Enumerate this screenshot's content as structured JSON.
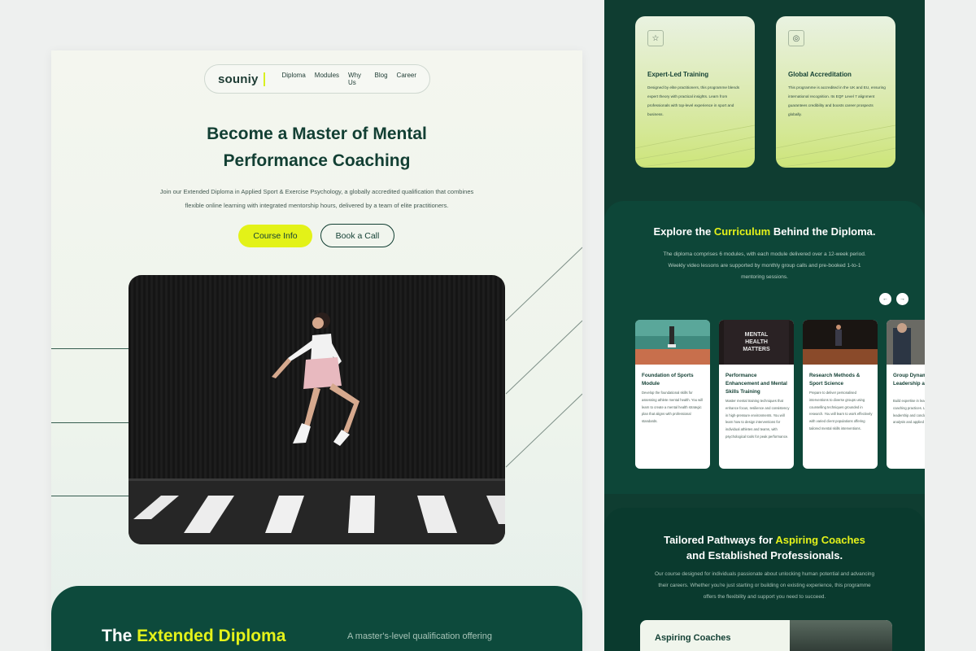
{
  "nav": {
    "logo": "souniy",
    "links": [
      "Diploma",
      "Modules",
      "Why Us",
      "Blog",
      "Career"
    ]
  },
  "hero": {
    "title_line1": "Become a Master of Mental",
    "title_line2": "Performance Coaching",
    "text_line1": "Join our Extended Diploma in Applied Sport & Exercise Psychology, a globally accredited qualification that combines",
    "text_line2": "flexible online learning with integrated mentorship hours, delivered by a team of elite practitioners.",
    "btn_primary": "Course Info",
    "btn_secondary": "Book a Call"
  },
  "extended": {
    "title_pre": "The ",
    "title_highlight": "Extended Diploma",
    "subtitle": "A master's-level qualification offering"
  },
  "features": [
    {
      "icon": "star-icon",
      "title": "Expert-Led Training",
      "text": "Designed by elite practitioners, this programme blends expert theory with practical insights. Learn from professionals with top-level experience in sport and business."
    },
    {
      "icon": "globe-icon",
      "title": "Global Accreditation",
      "text": "This programme is accredited in the UK and EU, ensuring international recognition. Its EQF Level 7 alignment guarantees credibility and boosts career prospects globally."
    }
  ],
  "curriculum": {
    "title_pre": "Explore the ",
    "title_highlight": "Curriculum",
    "title_post": " Behind the Diploma.",
    "text_line1": "The diploma comprises 6 modules, with each module delivered over a 12-week period.",
    "text_line2": "Weekly video lessons are supported by monthly group calls and pre-booked 1-to-1",
    "text_line3": "mentoring sessions.",
    "prev": "←",
    "next": "→",
    "modules": [
      {
        "title": "Foundation of Sports Module",
        "text": "Develop the foundational skills for assessing athlete mental health. You will learn to create a mental health strategic plan that aligns with professional standards."
      },
      {
        "title": "Performance Enhancement and Mental Skills Training",
        "text": "Master mental training techniques that enhance focus, resilience and consistency in high-pressure environments. You will learn how to design interventions for individual athletes and teams, with psychological tools for peak performance."
      },
      {
        "title": "Research Methods & Sport Science",
        "text": "Prepare to deliver personalised interventions to diverse groups using counselling techniques grounded in research. You will learn to work effectively with varied client populations offering tailored mental skills interventions."
      },
      {
        "title": "Group Dynamics, Leadership and Coaching",
        "text": "Build expertise in leading and developing coaching practices. Learn to design leadership and conduct psychological analysis and applied psychology."
      }
    ],
    "shirt_text": [
      "MENTAL",
      "HEALTH",
      "MATTERS"
    ]
  },
  "pathways": {
    "title_pre": "Tailored Pathways for ",
    "title_highlight": "Aspiring Coaches",
    "title_line2": "and Established Professionals.",
    "text_line1": "Our course designed for individuals passionate about unlocking human potential and advancing",
    "text_line2": "their careers. Whether you're just starting or building on existing experience, this programme",
    "text_line3": "offers the flexibility and support you need to succeed.",
    "card_title": "Aspiring Coaches"
  },
  "colors": {
    "brand_dark": "#0d4a3c",
    "accent": "#e3f218",
    "text_dark": "#123f33"
  }
}
